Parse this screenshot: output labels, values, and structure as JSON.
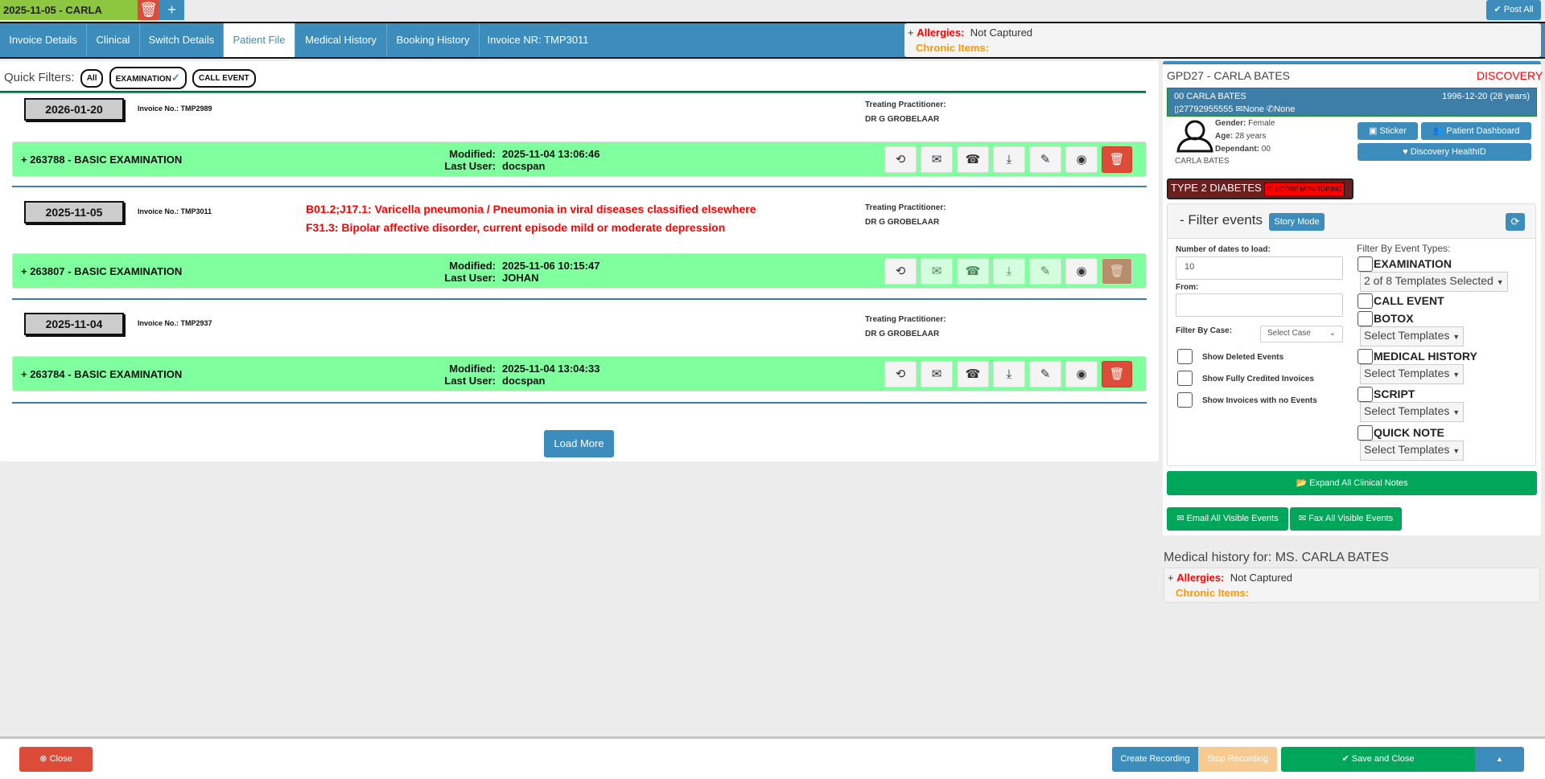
{
  "top": {
    "session_tab": "2025-11-05 - CARLA",
    "post_all": "Post All"
  },
  "nav": {
    "tabs": [
      "Invoice Details",
      "Clinical",
      "Switch Details",
      "Patient File",
      "Medical History",
      "Booking History",
      "Invoice NR: TMP3011"
    ],
    "active": "Patient File"
  },
  "allergy_box": {
    "plus": "+",
    "allergies_label": "Allergies:",
    "allergies_value": "Not Captured",
    "chronic_label": "Chronic Items:"
  },
  "quick_filters": {
    "label": "Quick Filters:",
    "items": [
      "All",
      "EXAMINATION",
      "CALL EVENT"
    ],
    "check": "✓"
  },
  "blocks": [
    {
      "date": "2026-01-20",
      "invoice": "Invoice No.: TMP2989",
      "diagnoses": [],
      "practitioner_label": "Treating Practitioner:",
      "practitioner": "DR G GROBELAAR",
      "event": {
        "title": "+ 263788 - BASIC EXAMINATION",
        "modified_label": "Modified:",
        "modified": "2025-11-04 13:06:46",
        "user_label": "Last User:",
        "user": "docspan"
      }
    },
    {
      "date": "2025-11-05",
      "invoice": "Invoice No.: TMP3011",
      "diagnoses": [
        "B01.2;J17.1: Varicella pneumonia / Pneumonia in viral diseases classified elsewhere",
        "F31.3: Bipolar affective disorder, current episode mild or moderate depression"
      ],
      "practitioner_label": "Treating Practitioner:",
      "practitioner": "DR G GROBELAAR",
      "event": {
        "title": "+ 263807 - BASIC EXAMINATION",
        "modified_label": "Modified:",
        "modified": "2025-11-06 10:15:47",
        "user_label": "Last User:",
        "user": "JOHAN"
      }
    },
    {
      "date": "2025-11-04",
      "invoice": "Invoice No.: TMP2937",
      "diagnoses": [],
      "practitioner_label": "Treating Practitioner:",
      "practitioner": "DR G GROBELAAR",
      "event": {
        "title": "+ 263784 - BASIC EXAMINATION",
        "modified_label": "Modified:",
        "modified": "2025-11-04 13:04:33",
        "user_label": "Last User:",
        "user": "docspan"
      }
    }
  ],
  "load_more": "Load More",
  "patient": {
    "header": "GPD27 - CARLA BATES",
    "scheme": "DISCOVERY",
    "name_line": "00 CARLA BATES",
    "dob": "1996-12-20 (28 years)",
    "phone": "27792955555",
    "email": "None",
    "tel": "None",
    "gender_label": "Gender:",
    "gender": "Female",
    "age_label": "Age:",
    "age": "28 years",
    "dep_label": "Dependant:",
    "dep": "00",
    "avatar_name": "CARLA BATES",
    "sticker": "Sticker",
    "dashboard": "Patient Dashboard",
    "healthid": "Discovery HealthID",
    "condition": "TYPE 2 DIABETES",
    "condition_tag": "GLUCOSE MONITORING"
  },
  "filter": {
    "title": "- Filter events",
    "story_mode": "Story Mode",
    "dates_label": "Number of dates to load:",
    "dates_value": "10",
    "from_label": "From:",
    "case_label": "Filter By Case:",
    "case_select": "Select Case",
    "show_deleted": "Show Deleted Events",
    "show_credited": "Show Fully Credited Invoices",
    "show_no_events": "Show Invoices with no Events",
    "types_label": "Filter By Event Types:",
    "types": [
      {
        "name": "EXAMINATION",
        "select": "2 of 8 Templates Selected"
      },
      {
        "name": "CALL EVENT"
      },
      {
        "name": "BOTOX",
        "select": "Select Templates"
      },
      {
        "name": "MEDICAL HISTORY",
        "select": "Select Templates"
      },
      {
        "name": "SCRIPT",
        "select": "Select Templates"
      },
      {
        "name": "QUICK NOTE",
        "select": "Select Templates"
      }
    ]
  },
  "actions": {
    "expand": "Expand All Clinical Notes",
    "email": "Email All Visible Events",
    "fax": "Fax All Visible Events"
  },
  "medhist": {
    "title": "Medical history for: MS. CARLA BATES",
    "plus": "+",
    "allergies_label": "Allergies:",
    "allergies_value": "Not Captured",
    "chronic_label": "Chronic Items:"
  },
  "footer": {
    "close": "Close",
    "create_recording": "Create Recording",
    "stop_recording": "Stop Recording",
    "save_close": "Save and Close"
  },
  "colors": {
    "primary": "#3c8dbc",
    "success": "#00a65a",
    "danger": "#dd4b39",
    "event_bg": "#80ff9f"
  }
}
